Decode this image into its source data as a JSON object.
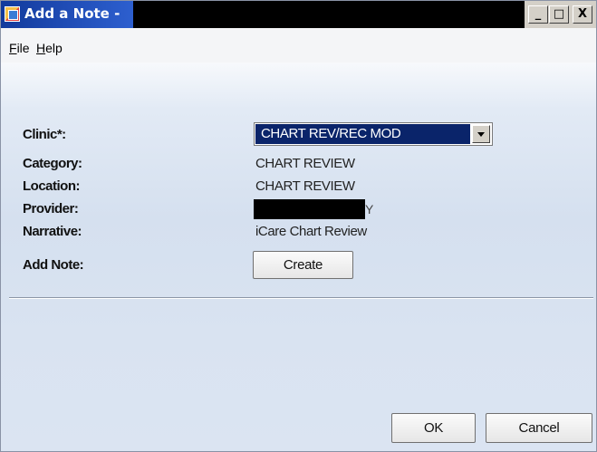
{
  "window": {
    "title": "Add a Note -",
    "controls": {
      "minimize": "_",
      "maximize": "□",
      "close": "X"
    }
  },
  "menu": {
    "file": {
      "mnemonic": "F",
      "rest": "ile"
    },
    "help": {
      "mnemonic": "H",
      "rest": "elp"
    }
  },
  "form": {
    "clinic_label": "Clinic*:",
    "clinic_value": "CHART REV/REC MOD",
    "category_label": "Category:",
    "category_value": "CHART REVIEW",
    "location_label": "Location:",
    "location_value": "CHART REVIEW",
    "provider_label": "Provider:",
    "provider_tail": "Y",
    "narrative_label": "Narrative:",
    "narrative_value": "iCare Chart Review",
    "add_note_label": "Add Note:",
    "create_button": "Create"
  },
  "footer": {
    "ok_button": "OK",
    "cancel_button": "Cancel"
  },
  "colors": {
    "title_gradient_start": "#123a9c",
    "selection_bg": "#0a246a",
    "panel_bg": "#d5e0ef"
  }
}
